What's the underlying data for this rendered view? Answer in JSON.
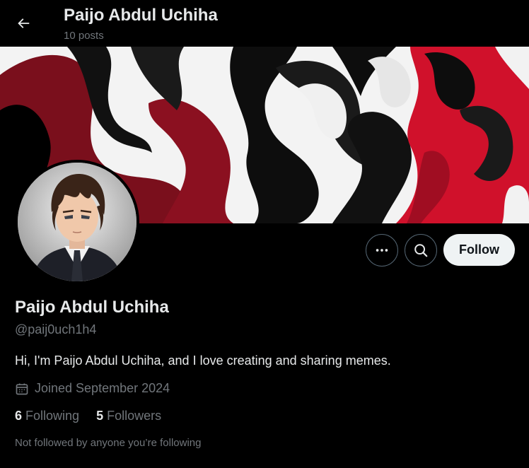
{
  "header": {
    "name": "Paijo Abdul Uchiha",
    "posts": "10 posts"
  },
  "profile": {
    "display_name": "Paijo Abdul Uchiha",
    "handle": "@paij0uch1h4",
    "bio": "Hi, I'm Paijo Abdul Uchiha, and I love creating and sharing memes.",
    "joined": "Joined September 2024",
    "following_count": "6",
    "following_label": "Following",
    "followers_count": "5",
    "followers_label": "Followers",
    "not_followed": "Not followed by anyone you’re following"
  },
  "actions": {
    "follow_label": "Follow"
  },
  "icons": {
    "back": "arrow-left-icon",
    "more": "more-dots-icon",
    "search": "search-icon",
    "calendar": "calendar-icon"
  },
  "colors": {
    "background": "#000000",
    "text_primary": "#e7e9ea",
    "text_secondary": "#71767b",
    "button_light": "#eff3f4",
    "border": "#536471",
    "banner_red": "#d0112b",
    "banner_dark_red": "#7a0f1c"
  }
}
